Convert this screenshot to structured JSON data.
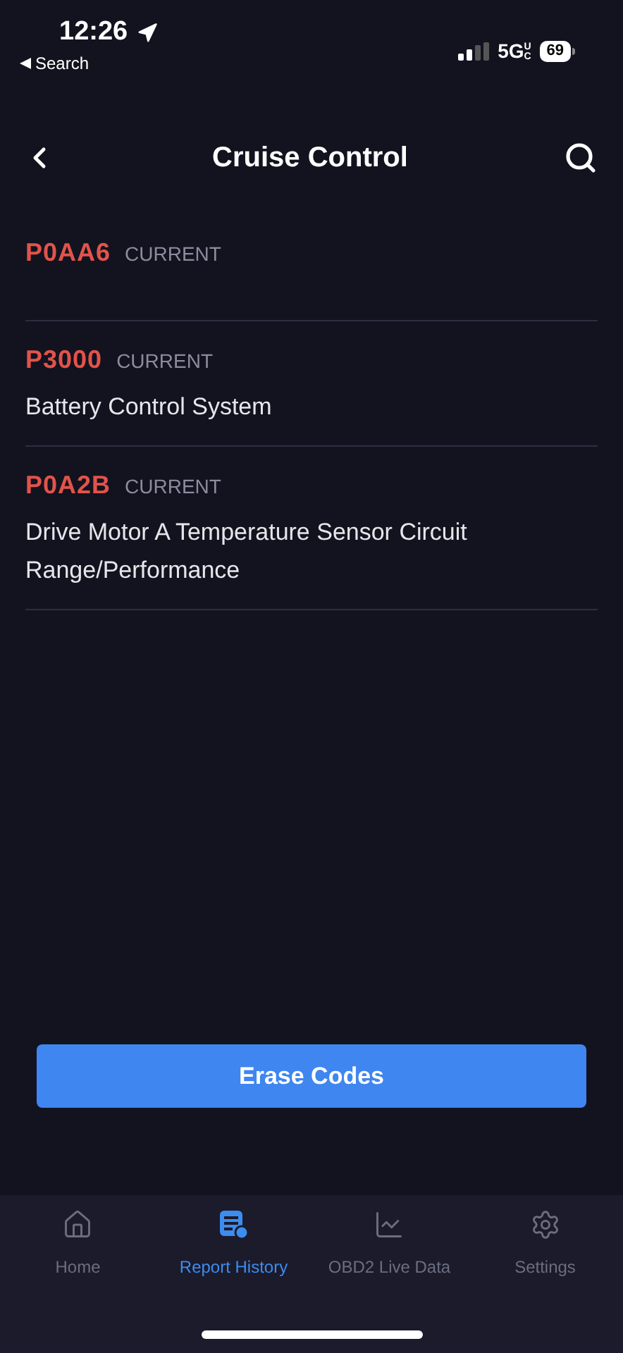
{
  "status_bar": {
    "time": "12:26",
    "back_label": "Search",
    "network": "5G",
    "network_suffix": "UC",
    "battery": "69"
  },
  "header": {
    "title": "Cruise Control"
  },
  "codes": [
    {
      "code": "P0AA6",
      "status": "CURRENT"
    },
    {
      "code": "P3000",
      "status": "CURRENT",
      "description": "Battery Control System"
    },
    {
      "code": "P0A2B",
      "status": "CURRENT",
      "description": "Drive Motor A Temperature Sensor Circuit Range/Performance"
    }
  ],
  "erase_button": "Erase Codes",
  "tab_bar": [
    {
      "label": "Home",
      "kind": "home",
      "selected": false
    },
    {
      "label": "Report History",
      "kind": "report",
      "selected": true
    },
    {
      "label": "OBD2 Live Data",
      "kind": "chart",
      "selected": false
    },
    {
      "label": "Settings",
      "kind": "settings",
      "selected": false
    }
  ]
}
